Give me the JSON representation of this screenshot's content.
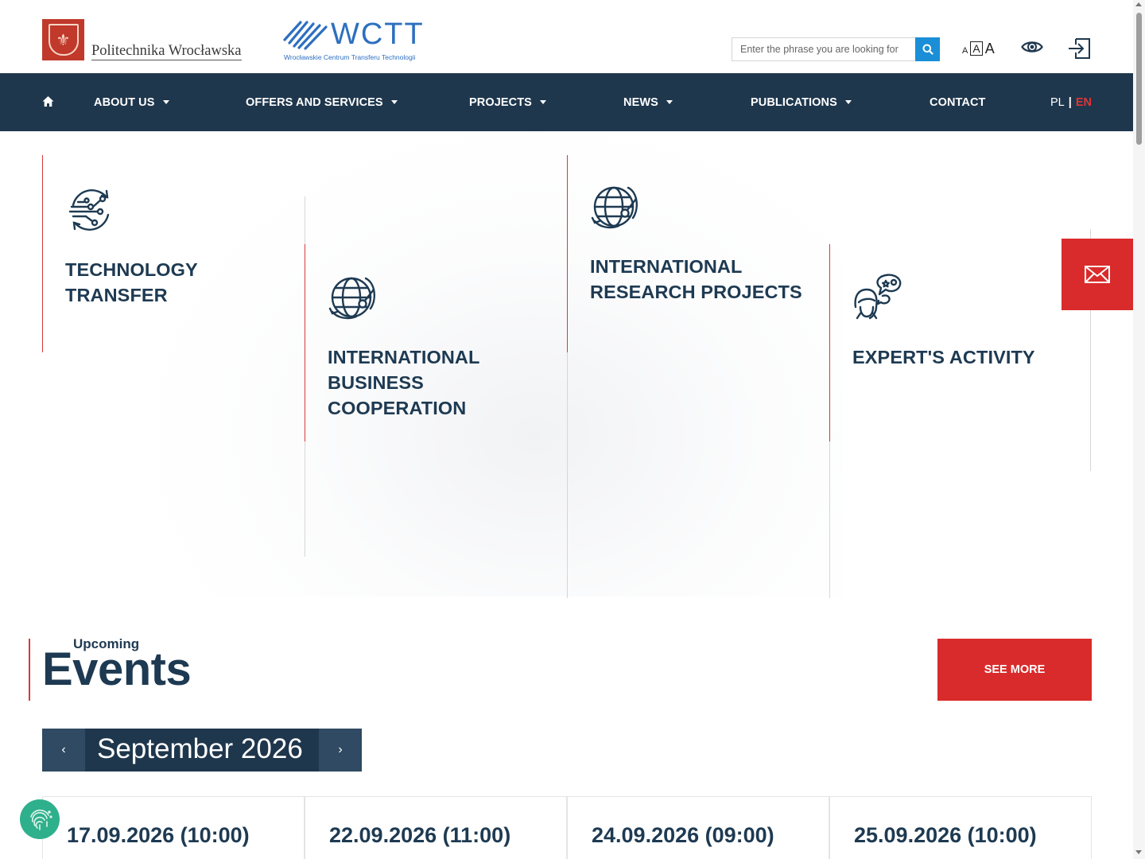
{
  "header": {
    "university_name": "Politechnika Wrocławska",
    "crest_glyph": "⚜",
    "wctt_name": "WCTT",
    "wctt_subtitle": "Wrocławskie Centrum Transferu Technologii",
    "search": {
      "placeholder": "Enter the phrase you are looking for"
    },
    "font_size": {
      "small": "A",
      "medium": "A",
      "large": "A"
    }
  },
  "nav": {
    "items": [
      {
        "label": "ABOUT US"
      },
      {
        "label": "OFFERS AND SERVICES"
      },
      {
        "label": "PROJECTS"
      },
      {
        "label": "NEWS"
      },
      {
        "label": "PUBLICATIONS"
      },
      {
        "label": "CONTACT"
      }
    ],
    "lang": {
      "pl": "PL",
      "separator": "|",
      "en": "EN"
    }
  },
  "tiles": [
    {
      "title_line1": "TECHNOLOGY",
      "title_line2": "TRANSFER",
      "icon": "technology-transfer-icon"
    },
    {
      "title_line1": "INTERNATIONAL",
      "title_line2": "BUSINESS",
      "title_line3": "COOPERATION",
      "icon": "globe-network-icon"
    },
    {
      "title_line1": "INTERNATIONAL",
      "title_line2": "RESEARCH PROJECTS",
      "icon": "globe-network-icon"
    },
    {
      "title_line1": "EXPERT'S ACTIVITY",
      "icon": "expert-chat-icon"
    }
  ],
  "events": {
    "small_title": "Upcoming",
    "big_title": "Events",
    "see_more": "SEE MORE",
    "month": "September 2026",
    "prev": "‹",
    "next": "›",
    "cards": [
      {
        "date": "17.09.2026 (10:00)"
      },
      {
        "date": "22.09.2026 (11:00)"
      },
      {
        "date": "24.09.2026 (09:00)"
      },
      {
        "date": "25.09.2026 (10:00)"
      }
    ]
  },
  "colors": {
    "nav_bg": "#1f374d",
    "accent_red": "#d92b2b",
    "heading": "#1e3a52",
    "search_btn": "#1a8ed6",
    "badge_green": "#2fb08c"
  }
}
